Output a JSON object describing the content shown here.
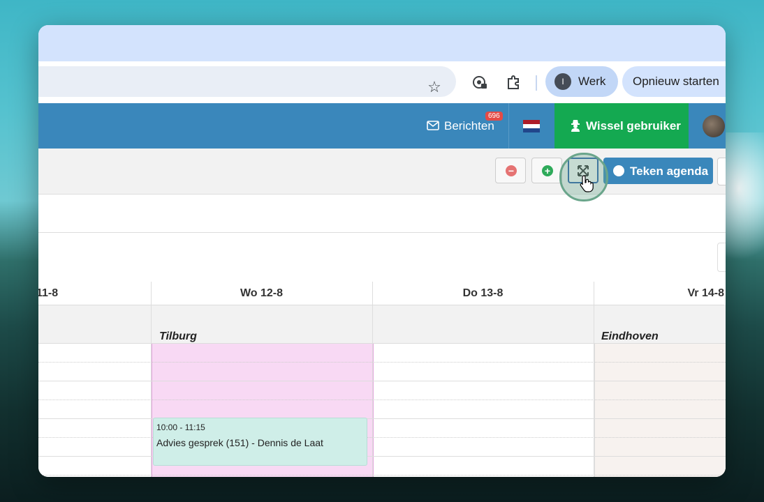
{
  "browser": {
    "profile_initial": "I",
    "profile_name": "Werk",
    "restart_label": "Opnieuw starten"
  },
  "app_nav": {
    "messages_label": "Berichten",
    "messages_badge": "696",
    "switch_user_label": "Wissel gebruiker"
  },
  "agenda_toolbar": {
    "draw_agenda_label": "Teken agenda"
  },
  "calendar": {
    "columns": [
      {
        "label": "11-8",
        "location": ""
      },
      {
        "label": "Wo 12-8",
        "location": "Tilburg"
      },
      {
        "label": "Do 13-8",
        "location": ""
      },
      {
        "label": "Vr 14-8",
        "location": "Eindhoven"
      }
    ],
    "event": {
      "time": "10:00 - 11:15",
      "title": "Advies gesprek (151) - Dennis de Laat"
    }
  },
  "colors": {
    "nav_blue": "#3a87bb",
    "switch_green": "#14a951",
    "event_bg": "#cfeee8",
    "tilburg_bg": "#f8d9f4"
  }
}
